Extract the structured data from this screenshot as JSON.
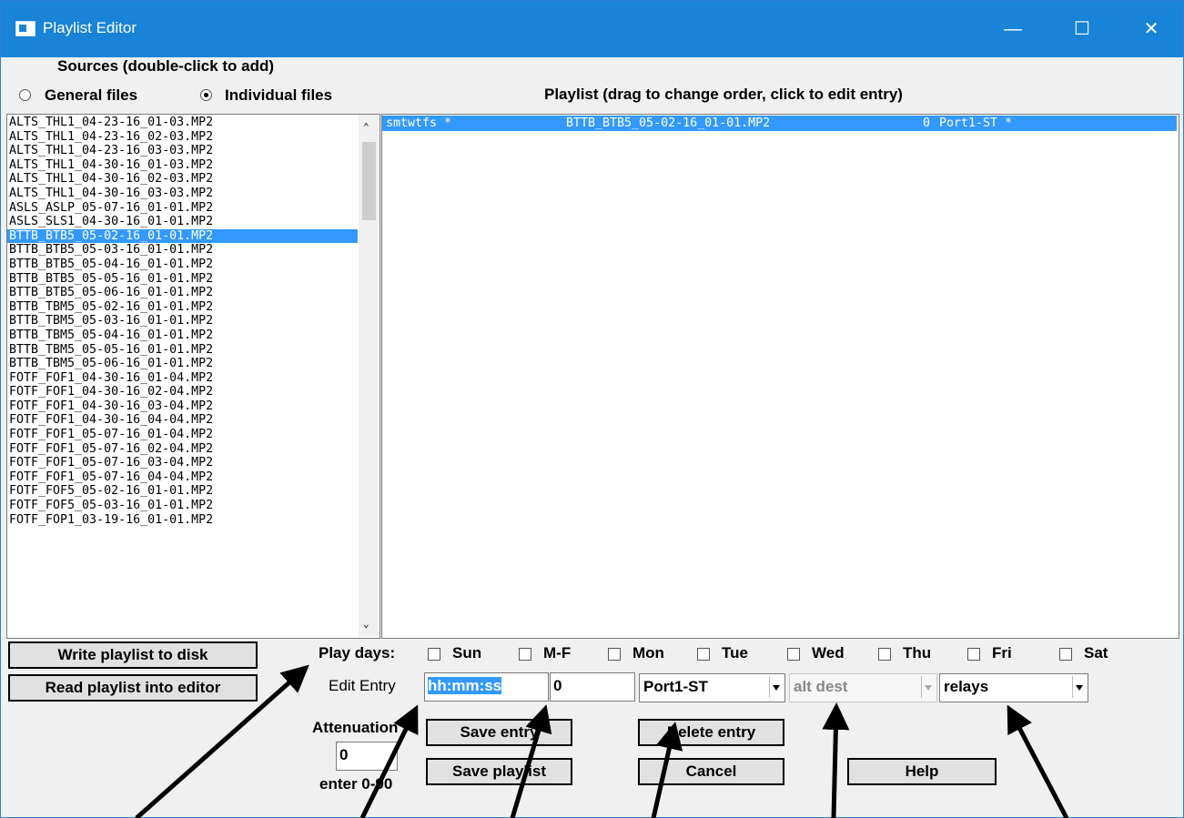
{
  "window": {
    "title": "Playlist Editor"
  },
  "sources": {
    "heading": "Sources (double-click to add)",
    "radio_general": "General files",
    "radio_individual": "Individual files",
    "selected_radio": "individual",
    "items": [
      "ALTS_THL1_04-23-16_01-03.MP2",
      "ALTS_THL1_04-23-16_02-03.MP2",
      "ALTS_THL1_04-23-16_03-03.MP2",
      "ALTS_THL1_04-30-16_01-03.MP2",
      "ALTS_THL1_04-30-16_02-03.MP2",
      "ALTS_THL1_04-30-16_03-03.MP2",
      "ASLS_ASLP_05-07-16_01-01.MP2",
      "ASLS_SLS1_04-30-16_01-01.MP2",
      "BTTB_BTB5_05-02-16_01-01.MP2",
      "BTTB_BTB5_05-03-16_01-01.MP2",
      "BTTB_BTB5_05-04-16_01-01.MP2",
      "BTTB_BTB5_05-05-16_01-01.MP2",
      "BTTB_BTB5_05-06-16_01-01.MP2",
      "BTTB_TBM5_05-02-16_01-01.MP2",
      "BTTB_TBM5_05-03-16_01-01.MP2",
      "BTTB_TBM5_05-04-16_01-01.MP2",
      "BTTB_TBM5_05-05-16_01-01.MP2",
      "BTTB_TBM5_05-06-16_01-01.MP2",
      "FOTF_FOF1_04-30-16_01-04.MP2",
      "FOTF_FOF1_04-30-16_02-04.MP2",
      "FOTF_FOF1_04-30-16_03-04.MP2",
      "FOTF_FOF1_04-30-16_04-04.MP2",
      "FOTF_FOF1_05-07-16_01-04.MP2",
      "FOTF_FOF1_05-07-16_02-04.MP2",
      "FOTF_FOF1_05-07-16_03-04.MP2",
      "FOTF_FOF1_05-07-16_04-04.MP2",
      "FOTF_FOF5_05-02-16_01-01.MP2",
      "FOTF_FOF5_05-03-16_01-01.MP2",
      "FOTF_FOP1_03-19-16_01-01.MP2"
    ],
    "selected_index": 8
  },
  "playlist": {
    "heading": "Playlist (drag to change order, click to edit entry)",
    "rows": [
      {
        "days": "smtwtfs *",
        "file": "BTTB_BTB5_05-02-16_01-01.MP2",
        "atten": "0",
        "dest": "Port1-ST *"
      }
    ]
  },
  "buttons": {
    "write": "Write playlist to disk",
    "read": "Read playlist into editor",
    "save_entry": "Save entry",
    "delete_entry": "Delete entry",
    "save_playlist": "Save playlist",
    "cancel": "Cancel",
    "help": "Help"
  },
  "play_days": {
    "label": "Play days:",
    "days": [
      "Sun",
      "M-F",
      "Mon",
      "Tue",
      "Wed",
      "Thu",
      "Fri",
      "Sat"
    ]
  },
  "edit_entry": {
    "label": "Edit Entry",
    "time": "hh:mm:ss",
    "attenuation_value": "0",
    "dest": "Port1-ST",
    "alt_dest": "alt dest",
    "relays": "relays"
  },
  "attenuation": {
    "label": "Attenuation",
    "value": "0",
    "hint": "enter 0-90"
  }
}
